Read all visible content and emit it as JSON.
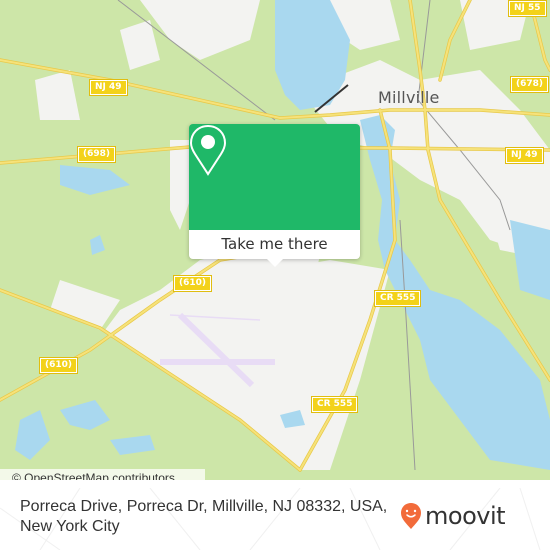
{
  "map": {
    "city_label": "Millville",
    "road_shields": [
      {
        "id": "nj49-west",
        "label": "NJ 49"
      },
      {
        "id": "cr698",
        "label": "(698)"
      },
      {
        "id": "nj55",
        "label": "NJ 55"
      },
      {
        "id": "cr678",
        "label": "(678)"
      },
      {
        "id": "nj49-east",
        "label": "NJ 49"
      },
      {
        "id": "cr610-north",
        "label": "(610)"
      },
      {
        "id": "cr610-south",
        "label": "(610)"
      },
      {
        "id": "cr555-north",
        "label": "CR 555"
      },
      {
        "id": "cr555-south",
        "label": "CR 555"
      }
    ],
    "colors": {
      "forest": "#cde6a8",
      "land": "#f3f3f1",
      "water": "#a9d8ef",
      "road": "#f6e27a",
      "road_edge": "#e8c94a",
      "airfield": "#e8dcf5",
      "accent_green": "#1fb868",
      "moovit_orange": "#f26b3a"
    }
  },
  "popup": {
    "icon": "location-pin-icon",
    "button_label": "Take me there"
  },
  "attribution": "© OpenStreetMap contributors",
  "footer": {
    "address": "Porreca Drive, Porreca Dr, Millville, NJ 08332, USA, New York City",
    "logo_text": "moovit",
    "logo_icon": "moovit-pin-smile-icon"
  }
}
